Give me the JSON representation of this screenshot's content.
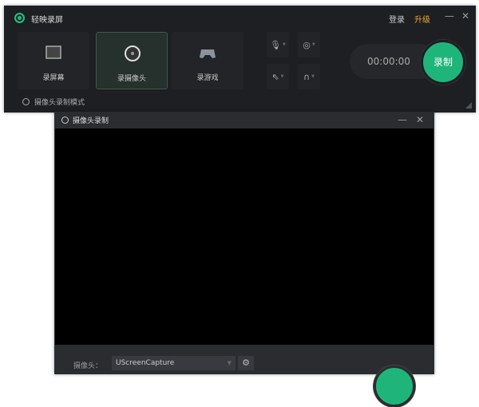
{
  "main": {
    "title": "轻映录屏",
    "login": "登录",
    "upgrade": "升级",
    "minimize": "—",
    "close": "✕",
    "modes": [
      {
        "label": "录屏幕",
        "icon": "screen-icon"
      },
      {
        "label": "录摄像头",
        "icon": "camera-icon"
      },
      {
        "label": "录游戏",
        "icon": "gamepad-icon"
      }
    ],
    "timer": "00:00:00",
    "record": "录制",
    "mode_label": "摄像头录制模式"
  },
  "camera_window": {
    "title": "摄像头录制",
    "minimize": "—",
    "close": "✕",
    "camera_label": "摄像头：",
    "camera_value": "UScreenCapture"
  },
  "colors": {
    "accent": "#1fb57a",
    "upgrade": "#f2a43a"
  }
}
